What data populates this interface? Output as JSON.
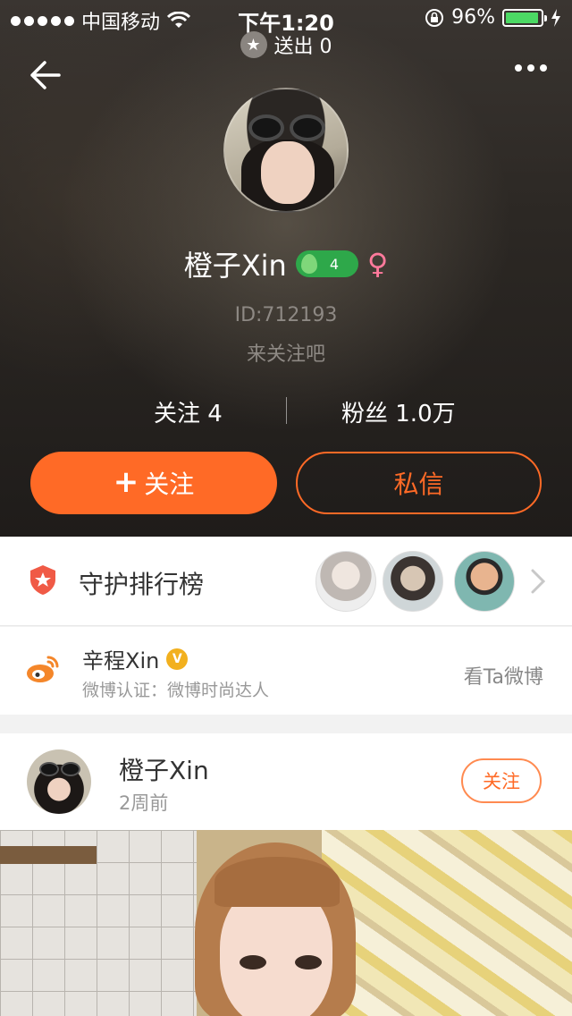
{
  "status_bar": {
    "carrier": "中国移动",
    "time": "下午1:20",
    "battery": "96%",
    "battery_level": 0.96
  },
  "header": {
    "sent_label": "送出 0"
  },
  "profile": {
    "name": "橙子Xin",
    "level": "4",
    "gender_symbol": "♀",
    "id_text": "ID:712193",
    "bio": "来关注吧",
    "following": "关注 4",
    "fans": "粉丝 1.0万",
    "follow_button": "关注",
    "message_button": "私信"
  },
  "guard_rank": {
    "title": "守护排行榜"
  },
  "weibo": {
    "name": "辛程Xin",
    "verify_badge": "V",
    "description": "微博认证：微博时尚达人",
    "link": "看Ta微博"
  },
  "post": {
    "author": "橙子Xin",
    "time": "2周前",
    "follow_button": "关注"
  },
  "colors": {
    "accent": "#ff6a26",
    "level_green": "#2ea84a",
    "gender_pink": "#ff7a9c"
  }
}
